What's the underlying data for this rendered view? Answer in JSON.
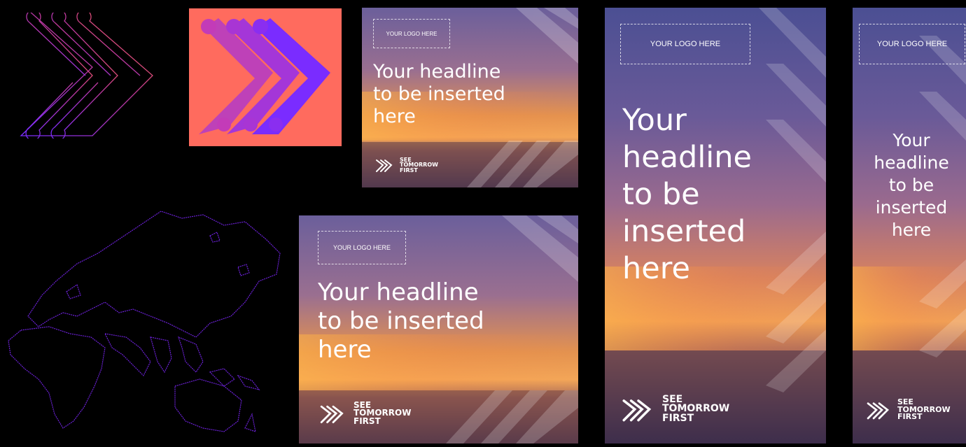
{
  "colors": {
    "background": "#000000",
    "tile_coral": "#ff6b5e",
    "brand_purple": "#7a2cff",
    "brand_orange": "#ff6a3d",
    "map_purple": "#6b21d6"
  },
  "icons": {
    "chevron_outline": "triple-chevron-outline-icon",
    "chevron_filled": "triple-chevron-filled-icon",
    "map": "world-map-outline",
    "brand_mark": "triple-chevron-brand-icon"
  },
  "banners": [
    {
      "logo_placeholder": "YOUR LOGO HERE",
      "headline": [
        "Your headline",
        "to be inserted",
        "here"
      ],
      "brand": [
        "SEE",
        "TOMORROW",
        "FIRST"
      ]
    },
    {
      "logo_placeholder": "YOUR LOGO HERE",
      "headline": [
        "Your headline",
        "to be inserted",
        "here"
      ],
      "brand": [
        "SEE",
        "TOMORROW",
        "FIRST"
      ]
    },
    {
      "logo_placeholder": "YOUR LOGO HERE",
      "headline": [
        "Your",
        "headline",
        "to be",
        "inserted",
        "here"
      ],
      "brand": [
        "SEE",
        "TOMORROW",
        "FIRST"
      ]
    },
    {
      "logo_placeholder": "YOUR LOGO HERE",
      "headline": [
        "Your",
        "headline",
        "to be",
        "inserted",
        "here"
      ],
      "brand": [
        "SEE",
        "TOMORROW",
        "FIRST"
      ]
    }
  ]
}
